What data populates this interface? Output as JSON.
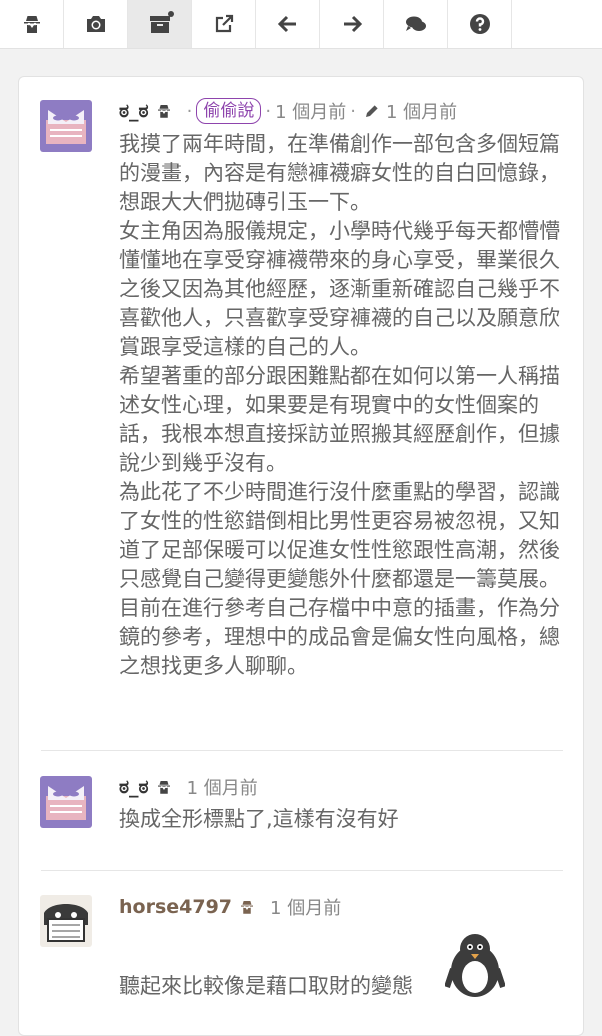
{
  "toolbar": {
    "buttons": [
      {
        "icon": "spy-icon"
      },
      {
        "icon": "camera-icon"
      },
      {
        "icon": "archive-icon",
        "active": true,
        "notification_dot": true
      },
      {
        "icon": "external-link-icon"
      },
      {
        "icon": "arrow-left-icon"
      },
      {
        "icon": "arrow-right-icon"
      },
      {
        "icon": "comments-icon"
      },
      {
        "icon": "question-icon"
      }
    ]
  },
  "post": {
    "author": "ಠ_ಠ",
    "tag": "偷偷說",
    "separator": "·",
    "time": "1 個月前",
    "edited_time": "1 個月前",
    "paragraphs": [
      "我摸了兩年時間，在準備創作一部包含多個短篇的漫畫，內容是有戀褲襪癖女性的自白回憶錄，想跟大大們拋磚引玉一下。",
      "女主角因為服儀規定，小學時代幾乎每天都懵懵懂懂地在享受穿褲襪帶來的身心享受，畢業很久之後又因為其他經歷，逐漸重新確認自己幾乎不喜歡他人，只喜歡享受穿褲襪的自己以及願意欣賞跟享受這樣的自己的人。",
      "希望著重的部分跟困難點都在如何以第一人稱描述女性心理，如果要是有現實中的女性個案的話，我根本想直接採訪並照搬其經歷創作，但據說少到幾乎沒有。",
      "為此花了不少時間進行沒什麼重點的學習，認識了女性的性慾錯倒相比男性更容易被忽視，又知道了足部保暖可以促進女性性慾跟性高潮，然後只感覺自己變得更變態外什麼都還是一籌莫展。",
      "目前在進行參考自己存檔中中意的插畫，作為分鏡的參考，理想中的成品會是偏女性向風格，總之想找更多人聊聊。"
    ]
  },
  "replies": [
    {
      "author": "ಠ_ಠ",
      "time": "1 個月前",
      "text": "換成全形標點了,這樣有沒有好"
    },
    {
      "author": "horse4797",
      "time": "1 個月前",
      "text": "聽起來比較像是藉口取財的變態"
    }
  ],
  "colors": {
    "tag": "#8e44ad",
    "avatar_bg": "#8e7cc3",
    "text": "#666666"
  }
}
